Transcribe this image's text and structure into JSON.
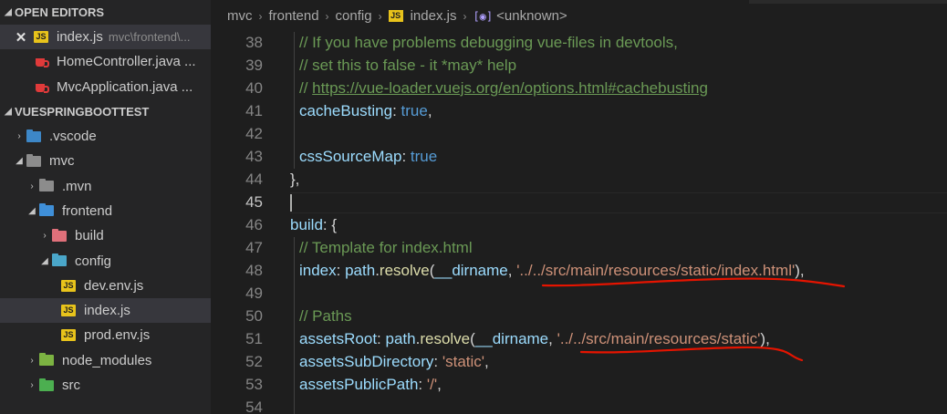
{
  "sidebar": {
    "open_editors_title": "OPEN EDITORS",
    "open_editors": [
      {
        "name": "index.js",
        "path": "mvc\\frontend\\...",
        "icon": "js-file-icon",
        "active": true
      },
      {
        "name": "HomeController.java ...",
        "icon": "java-file-icon"
      },
      {
        "name": "MvcApplication.java ...",
        "icon": "java-file-icon"
      }
    ],
    "project_title": "VUESPRINGBOOTTEST",
    "tree": [
      {
        "name": ".vscode",
        "icon": "vscode-folder-icon"
      },
      {
        "name": "mvc",
        "icon": "folder-open-icon"
      },
      {
        "name": ".mvn",
        "icon": "folder-icon"
      },
      {
        "name": "frontend",
        "icon": "folder-open-icon"
      },
      {
        "name": "build",
        "icon": "build-folder-icon"
      },
      {
        "name": "config",
        "icon": "config-folder-icon"
      },
      {
        "name": "dev.env.js",
        "icon": "js-file-icon"
      },
      {
        "name": "index.js",
        "icon": "js-file-icon"
      },
      {
        "name": "prod.env.js",
        "icon": "js-file-icon"
      },
      {
        "name": "node_modules",
        "icon": "node-folder-icon"
      },
      {
        "name": "src",
        "icon": "src-folder-icon"
      }
    ]
  },
  "breadcrumb": {
    "items": [
      "mvc",
      "frontend",
      "config",
      "index.js",
      "<unknown>"
    ],
    "js_badge": "JS",
    "symbol_glyph": "[◉]"
  },
  "editor": {
    "current_line": 45,
    "lines": [
      {
        "n": "38",
        "text": "// If you have problems debugging vue-files in devtools,"
      },
      {
        "n": "39",
        "text": "// set this to false - it *may* help"
      },
      {
        "n": "40",
        "prefix": "// ",
        "url": "https://vue-loader.vuejs.org/en/options.html#cachebusting"
      },
      {
        "n": "41",
        "key": "cacheBusting",
        "value": "true"
      },
      {
        "n": "42"
      },
      {
        "n": "43",
        "key": "cssSourceMap",
        "value": "true"
      },
      {
        "n": "44",
        "text": "},"
      },
      {
        "n": "45"
      },
      {
        "n": "46",
        "key": "build",
        "text": ": {"
      },
      {
        "n": "47",
        "text": "// Template for index.html"
      },
      {
        "n": "48",
        "key": "index",
        "obj": "path",
        "fn": "resolve",
        "arg": "__dirname",
        "str": "'../../src/main/resources/static/index.html'"
      },
      {
        "n": "49"
      },
      {
        "n": "50",
        "text": "// Paths"
      },
      {
        "n": "51",
        "key": "assetsRoot",
        "obj": "path",
        "fn": "resolve",
        "arg": "__dirname",
        "str": "'../../src/main/resources/static'"
      },
      {
        "n": "52",
        "key": "assetsSubDirectory",
        "str": "'static'"
      },
      {
        "n": "53",
        "key": "assetsPublicPath",
        "str": "'/'"
      },
      {
        "n": "54"
      }
    ]
  },
  "colors": {
    "underline_annotation": "#e51400"
  }
}
